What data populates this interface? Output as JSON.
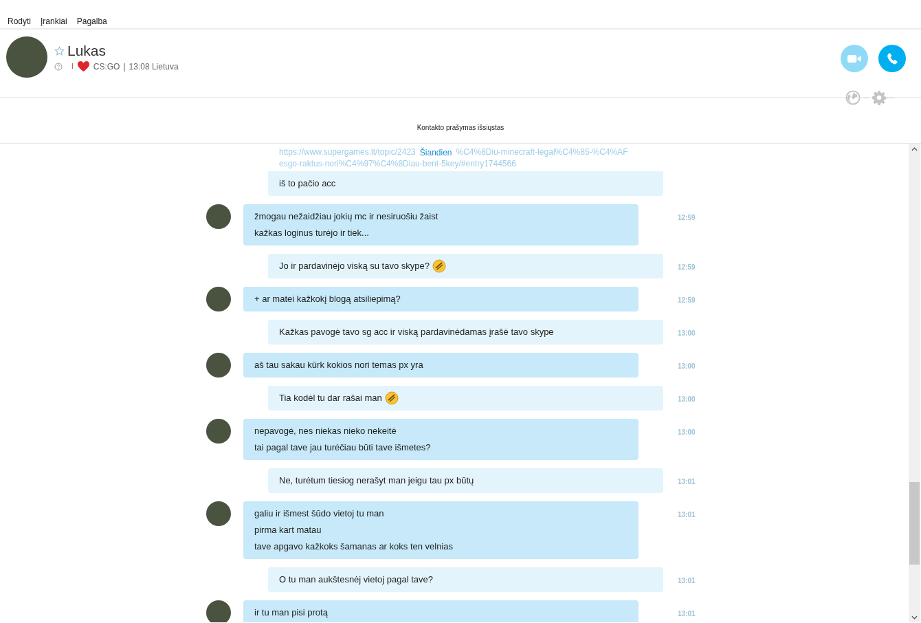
{
  "menu": [
    "Rodyti",
    "Įrankiai",
    "Pagalba"
  ],
  "contact": {
    "name": "Lukas",
    "favorite": false,
    "mood_prefix": "I",
    "mood": "CS:GO",
    "separator": "|",
    "local_time": "13:08 Lietuva"
  },
  "notice": "Kontakto prašymas išsiųstas",
  "date_divider": "Šiandien",
  "link_fragments": [
    "https://www.supergames.lt/topic/2423",
    "%C4%8Diu-minecraft-legal%C4%85-%C4%AF",
    "esgo-raktus-nori%C4%97%C4%8Diau-bent-5key/#entry1744566"
  ],
  "messages": [
    {
      "kind": "out",
      "lines": [
        "iš to pačio acc"
      ]
    },
    {
      "kind": "in",
      "lines": [
        "žmogau nežaidžiau jokių mc ir nesiruošiu žaist",
        "kažkas loginus turėjo ir tiek..."
      ],
      "time": "12:59"
    },
    {
      "kind": "out",
      "lines": [
        "Jo ir pardavinėjo viską su tavo skype?"
      ],
      "time": "12:59",
      "emoji": true
    },
    {
      "kind": "in",
      "lines": [
        "+ ar matei kažkokį blogą atsiliepimą?"
      ],
      "time": "12:59"
    },
    {
      "kind": "out",
      "lines": [
        "Kažkas pavogė tavo sg acc ir viską pardavinėdamas įrašė tavo skype"
      ],
      "time": "13:00"
    },
    {
      "kind": "in",
      "lines": [
        "aš tau sakau kūrk kokios nori temas px yra"
      ],
      "time": "13:00"
    },
    {
      "kind": "out",
      "lines": [
        "Tia kodėl tu dar rašai man"
      ],
      "time": "13:00",
      "emoji": true
    },
    {
      "kind": "in",
      "lines": [
        "nepavogė, nes niekas nieko nekeitė",
        "tai pagal tave jau turėčiau būti tave išmetes?"
      ],
      "time": "13:00"
    },
    {
      "kind": "out",
      "lines": [
        "Ne, turėtum tiesiog nerašyt man jeigu tau px būtų"
      ],
      "time": "13:01"
    },
    {
      "kind": "in",
      "lines": [
        "galiu ir išmest šūdo vietoj tu man",
        "pirma kart matau",
        "tave apgavo kažkoks šamanas ar koks ten velnias"
      ],
      "time": "13:01"
    },
    {
      "kind": "out",
      "lines": [
        "O tu man aukštesnėj vietoj pagal tave?"
      ],
      "time": "13:01"
    },
    {
      "kind": "in",
      "lines": [
        "ir tu man pisi protą"
      ],
      "time": "13:01"
    }
  ]
}
